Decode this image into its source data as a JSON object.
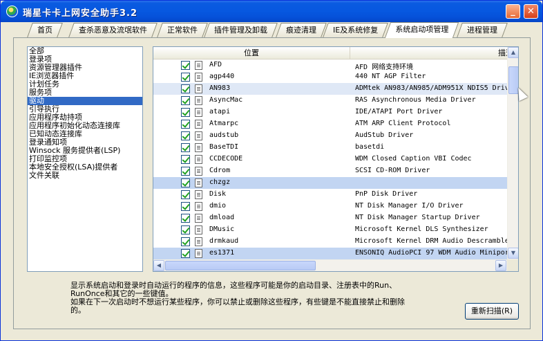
{
  "window": {
    "title": "瑞星卡卡上网安全助手3.2"
  },
  "titlebar": {
    "minimize_glyph": "_",
    "close_glyph": "✕"
  },
  "tabs": [
    {
      "label": "首页"
    },
    {
      "label": "查杀恶意及流氓软件"
    },
    {
      "label": "正常软件"
    },
    {
      "label": "插件管理及卸载"
    },
    {
      "label": "痕迹清理"
    },
    {
      "label": "IE及系统修复"
    },
    {
      "label": "系统启动项管理"
    },
    {
      "label": "进程管理"
    }
  ],
  "active_tab": "系统启动项管理",
  "categories": [
    {
      "label": "全部"
    },
    {
      "label": "登录项"
    },
    {
      "label": "资源管理器插件"
    },
    {
      "label": "IE浏览器插件"
    },
    {
      "label": "计划任务"
    },
    {
      "label": "服务项"
    },
    {
      "label": "驱动"
    },
    {
      "label": "引导执行"
    },
    {
      "label": "应用程序劫持项"
    },
    {
      "label": "应用程序初始化动态连接库"
    },
    {
      "label": "已知动态连接库"
    },
    {
      "label": "登录通知项"
    },
    {
      "label": "Winsock 服务提供者(LSP)"
    },
    {
      "label": "打印监控项"
    },
    {
      "label": "本地安全授权(LSA)提供者"
    },
    {
      "label": "文件关联"
    }
  ],
  "selected_category": "驱动",
  "table": {
    "columns": [
      "位置",
      "描述"
    ],
    "rows": [
      {
        "name": "AFD",
        "desc": "AFD 网络支持环境",
        "checked": true,
        "state": ""
      },
      {
        "name": "agp440",
        "desc": "440 NT AGP Filter",
        "checked": true,
        "state": ""
      },
      {
        "name": "AN983",
        "desc": "ADMtek AN983/AN985/ADM951X NDIS5 Driv",
        "checked": true,
        "state": "hl"
      },
      {
        "name": "AsyncMac",
        "desc": "RAS Asynchronous Media Driver",
        "checked": true,
        "state": ""
      },
      {
        "name": "atapi",
        "desc": "IDE/ATAPI Port Driver",
        "checked": true,
        "state": ""
      },
      {
        "name": "Atmarpc",
        "desc": "ATM ARP Client Protocol",
        "checked": true,
        "state": ""
      },
      {
        "name": "audstub",
        "desc": "AudStub Driver",
        "checked": true,
        "state": ""
      },
      {
        "name": "BaseTDI",
        "desc": "basetdi",
        "checked": true,
        "state": ""
      },
      {
        "name": "CCDECODE",
        "desc": "WDM Closed Caption VBI Codec",
        "checked": true,
        "state": ""
      },
      {
        "name": "Cdrom",
        "desc": "SCSI CD-ROM Driver",
        "checked": true,
        "state": ""
      },
      {
        "name": "chzgz",
        "desc": "",
        "checked": true,
        "state": "sel"
      },
      {
        "name": "Disk",
        "desc": "PnP Disk Driver",
        "checked": true,
        "state": ""
      },
      {
        "name": "dmio",
        "desc": "NT Disk Manager I/O Driver",
        "checked": true,
        "state": ""
      },
      {
        "name": "dmload",
        "desc": "NT Disk Manager Startup Driver",
        "checked": true,
        "state": ""
      },
      {
        "name": "DMusic",
        "desc": "Microsoft Kernel DLS Synthesizer",
        "checked": true,
        "state": ""
      },
      {
        "name": "drmkaud",
        "desc": "Microsoft Kernel DRM Audio Descramble",
        "checked": true,
        "state": ""
      },
      {
        "name": "es1371",
        "desc": "ENSONIQ AudioPCI 97 WDM Audio Minipor",
        "checked": true,
        "state": "sel"
      }
    ]
  },
  "scrollbar": {
    "up": "▲",
    "down": "▼",
    "left": "◀",
    "right": "▶"
  },
  "info": {
    "line1": "显示系统启动和登录时自动运行的程序的信息，这些程序可能是你的启动目录、注册表中的Run、",
    "line2": "RunOnce和其它的一些键值。",
    "line3": "如果在下一次启动时不想运行某些程序，你可以禁止或删除这些程序，有些键是不能直接禁止和删除",
    "line4": "的。"
  },
  "buttons": {
    "rescan": "重新扫描(R)"
  }
}
